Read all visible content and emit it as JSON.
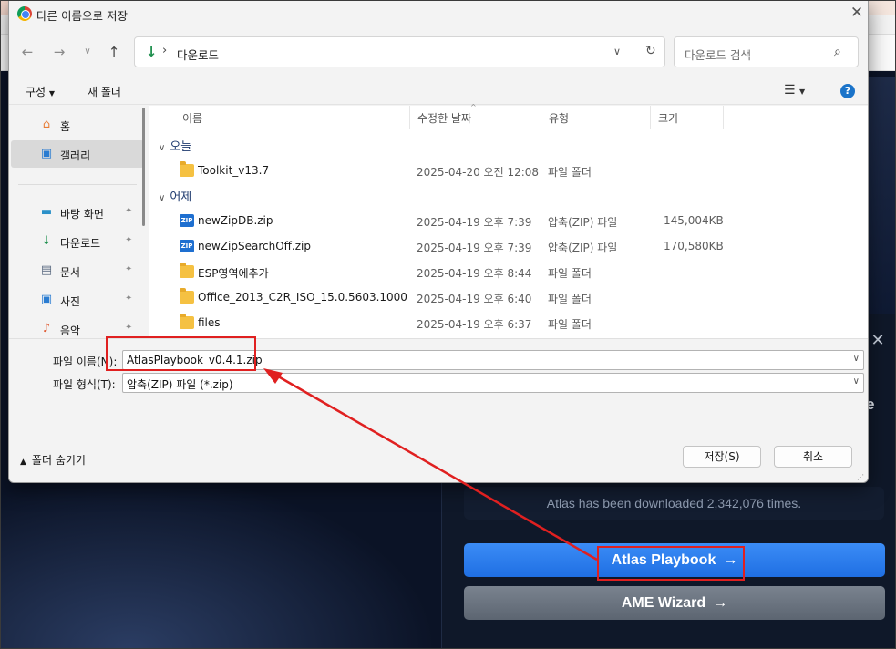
{
  "dialog": {
    "title": "다른 이름으로 저장",
    "address": "다운로드",
    "search_placeholder": "다운로드 검색",
    "toolbar": {
      "organize": "구성",
      "new_folder": "새 폴더"
    },
    "sidebar": [
      {
        "label": "홈",
        "icon": "home-icon",
        "pinned": false,
        "selected": false
      },
      {
        "label": "갤러리",
        "icon": "gallery-icon",
        "pinned": false,
        "selected": true
      },
      {
        "label": "바탕 화면",
        "icon": "desktop-icon",
        "pinned": true,
        "selected": false
      },
      {
        "label": "다운로드",
        "icon": "download-icon",
        "pinned": true,
        "selected": false
      },
      {
        "label": "문서",
        "icon": "document-icon",
        "pinned": true,
        "selected": false
      },
      {
        "label": "사진",
        "icon": "pictures-icon",
        "pinned": true,
        "selected": false
      },
      {
        "label": "음악",
        "icon": "music-icon",
        "pinned": true,
        "selected": false
      }
    ],
    "columns": {
      "name": "이름",
      "date": "수정한 날짜",
      "type": "유형",
      "size": "크기"
    },
    "groups": {
      "today": {
        "label": "오늘",
        "files": [
          {
            "name": "Toolkit_v13.7",
            "date": "2025-04-20 오전 12:08",
            "type": "파일 폴더",
            "size": "",
            "icon": "folder"
          }
        ]
      },
      "yesterday": {
        "label": "어제",
        "files": [
          {
            "name": "newZipDB.zip",
            "date": "2025-04-19 오후 7:39",
            "type": "압축(ZIP) 파일",
            "size": "145,004KB",
            "icon": "zip"
          },
          {
            "name": "newZipSearchOff.zip",
            "date": "2025-04-19 오후 7:39",
            "type": "압축(ZIP) 파일",
            "size": "170,580KB",
            "icon": "zip"
          },
          {
            "name": "ESP영역에추가",
            "date": "2025-04-19 오후 8:44",
            "type": "파일 폴더",
            "size": "",
            "icon": "folder"
          },
          {
            "name": "Office_2013_C2R_ISO_15.0.5603.1000_...",
            "date": "2025-04-19 오후 6:40",
            "type": "파일 폴더",
            "size": "",
            "icon": "folder"
          },
          {
            "name": "files",
            "date": "2025-04-19 오후 6:37",
            "type": "파일 폴더",
            "size": "",
            "icon": "folder"
          }
        ]
      }
    },
    "filename_label": "파일 이름(N):",
    "filename_value": "AtlasPlaybook_v0.4.1.zip",
    "filetype_label": "파일 형식(T):",
    "filetype_value": "압축(ZIP) 파일 (*.zip)",
    "hide_folders": "폴더 숨기기",
    "save_button": "저장(S)",
    "cancel_button": "취소"
  },
  "background": {
    "download_count_text": "Atlas has been downloaded 2,342,076 times.",
    "primary_button": "Atlas Playbook",
    "secondary_button": "AME Wizard",
    "partial_heading": "e"
  },
  "colors": {
    "annotation_red": "#e02020",
    "primary_blue": "#1f6fe3",
    "secondary_gray": "#5c6571",
    "help_blue": "#1a73c9"
  }
}
